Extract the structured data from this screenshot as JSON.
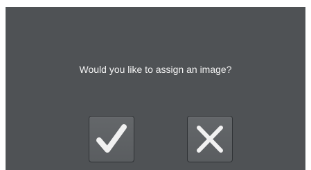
{
  "dialog": {
    "question": "Would you like to assign an image?",
    "buttons": {
      "confirm_icon": "checkmark-icon",
      "cancel_icon": "cross-icon"
    }
  },
  "colors": {
    "dialog_background": "#4f5255",
    "text": "#f4f4f4",
    "button_background": "#5f6265",
    "icon": "#f1f1f1"
  }
}
